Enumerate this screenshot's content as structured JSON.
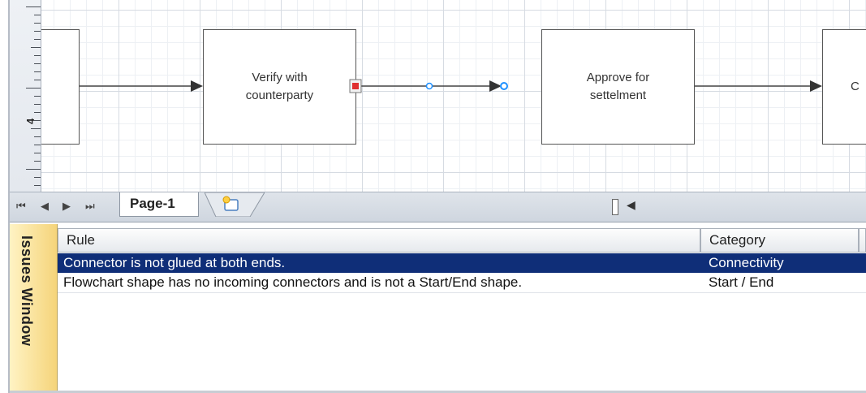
{
  "canvas": {
    "shapes": [
      {
        "id": "left",
        "text": ""
      },
      {
        "id": "verify",
        "line1": "Verify with",
        "line2": "counterparty"
      },
      {
        "id": "approve",
        "line1": "Approve for",
        "line2": "settelment"
      },
      {
        "id": "right",
        "text": "C"
      }
    ]
  },
  "ruler": {
    "label": "4"
  },
  "page_tabs": {
    "nav": {
      "first": "⏮",
      "prev": "◀",
      "next": "▶",
      "last": "⏭"
    },
    "active": "Page-1"
  },
  "issues_window": {
    "title": "Issues Window",
    "columns": [
      "Rule",
      "Category"
    ],
    "rows": [
      {
        "rule": "Connector is not glued at both ends.",
        "category": "Connectivity",
        "selected": true
      },
      {
        "rule": "Flowchart shape has no incoming connectors and is not a Start/End shape.",
        "category": "Start / End",
        "selected": false
      }
    ]
  },
  "colors": {
    "selection": "#0f2e78",
    "issues_side": "#f5d47a",
    "glue_error": "#e03030",
    "connector_point": "#1e90ff"
  }
}
